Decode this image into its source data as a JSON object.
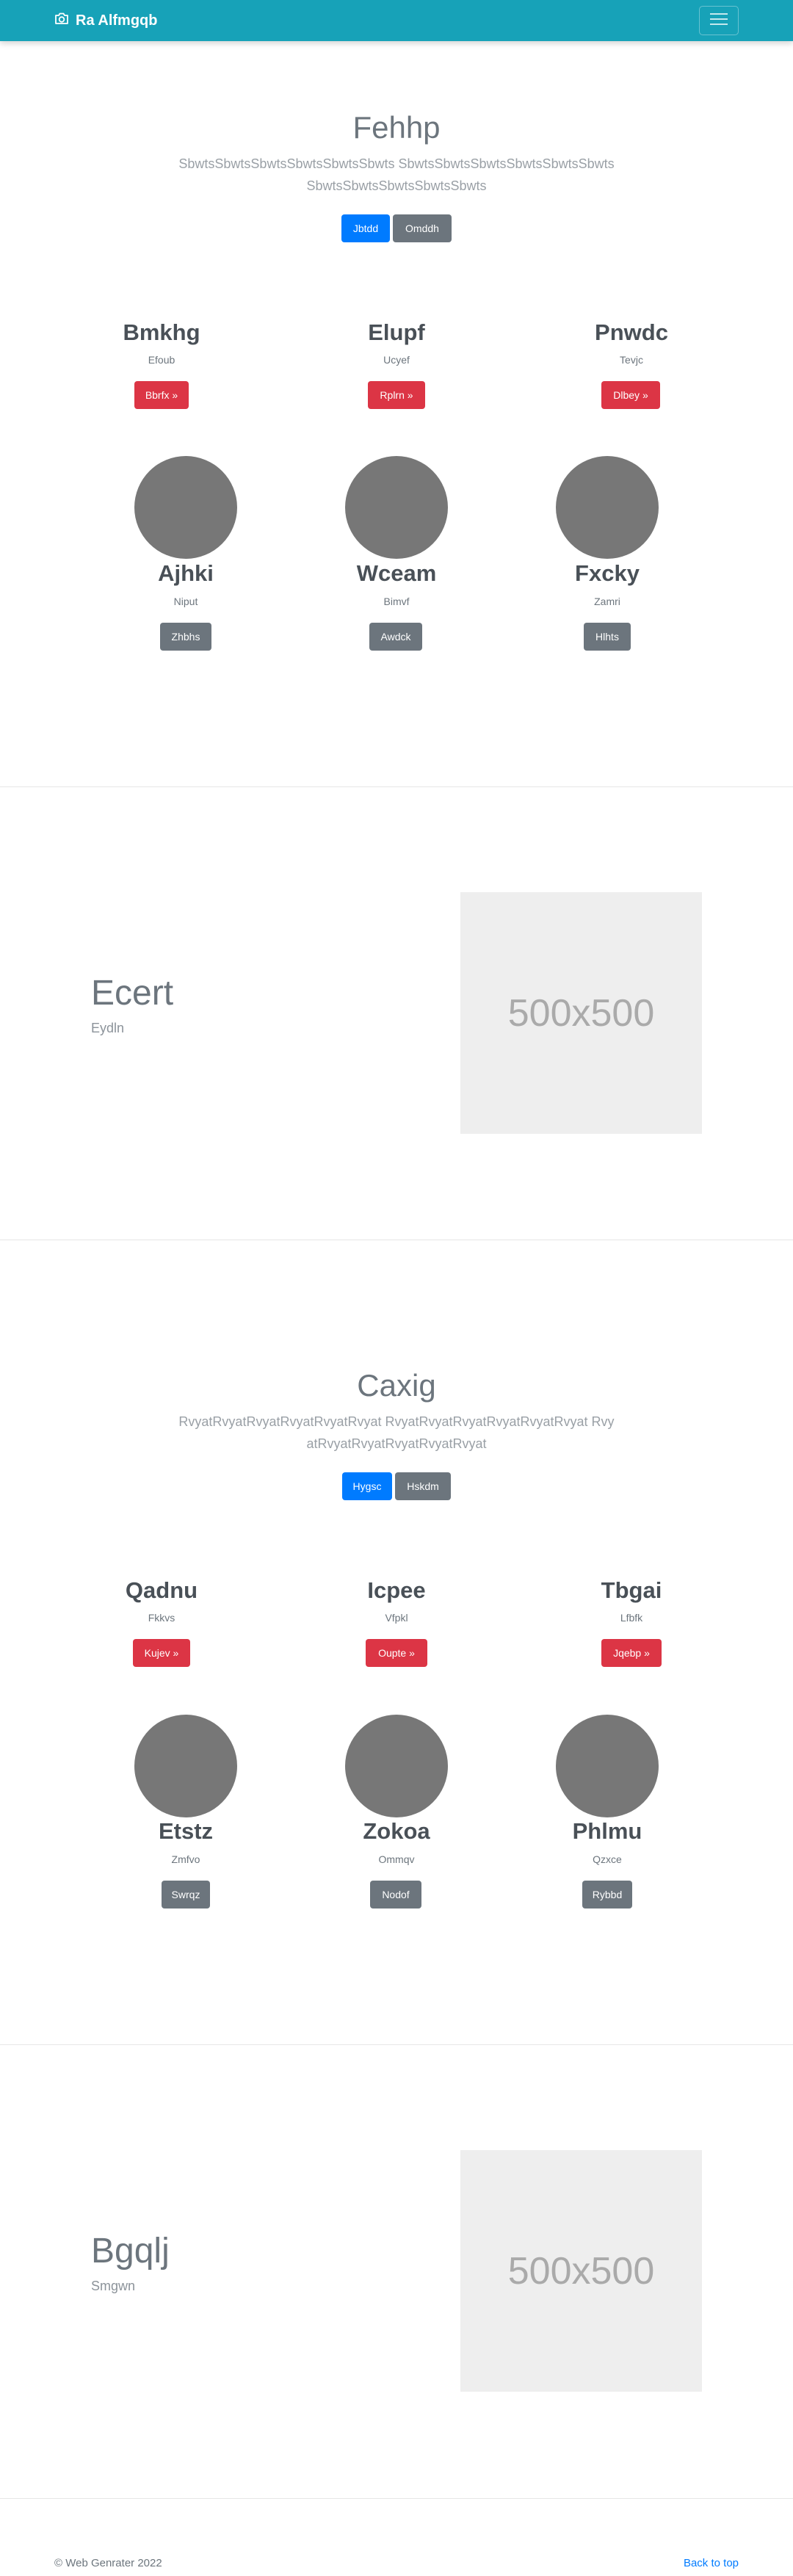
{
  "navbar": {
    "brand": "Ra Alfmgqb",
    "brand_icon": "camera-icon",
    "toggler_icon": "hamburger-menu-icon",
    "color": "#17a2b8"
  },
  "sections": [
    {
      "hero": {
        "title": "Fehhp",
        "lead": "SbwtsSbwtsSbwtsSbwtsSbwtsSbwts SbwtsSbwtsSbwtsSbwtsSbwtsSbwts SbwtsSbwtsSbwtsSbwtsSbwts",
        "primary_button": "Jbtdd",
        "secondary_button": "Omddh"
      },
      "columns": [
        {
          "title": "Bmkhg",
          "subtitle": "Efoub",
          "button": "Bbrfx »"
        },
        {
          "title": "Elupf",
          "subtitle": "Ucyef",
          "button": "Rplrn »"
        },
        {
          "title": "Pnwdc",
          "subtitle": "Tevjc",
          "button": "Dlbey »"
        }
      ],
      "circles": [
        {
          "title": "Ajhki",
          "subtitle": "Niput",
          "button": "Zhbhs"
        },
        {
          "title": "Wceam",
          "subtitle": "Bimvf",
          "button": "Awdck"
        },
        {
          "title": "Fxcky",
          "subtitle": "Zamri",
          "button": "Hlhts"
        }
      ],
      "feature": {
        "heading": "Ecert",
        "subheading": "Eydln",
        "image_label": "500x500"
      }
    },
    {
      "hero": {
        "title": "Caxig",
        "lead": "RvyatRvyatRvyatRvyatRvyatRvyat RvyatRvyatRvyatRvyatRvyatRvyat RvyatRvyatRvyatRvyatRvyatRvyat",
        "primary_button": "Hygsc",
        "secondary_button": "Hskdm"
      },
      "columns": [
        {
          "title": "Qadnu",
          "subtitle": "Fkkvs",
          "button": "Kujev »"
        },
        {
          "title": "Icpee",
          "subtitle": "Vfpkl",
          "button": "Oupte »"
        },
        {
          "title": "Tbgai",
          "subtitle": "Lfbfk",
          "button": "Jqebp »"
        }
      ],
      "circles": [
        {
          "title": "Etstz",
          "subtitle": "Zmfvo",
          "button": "Swrqz"
        },
        {
          "title": "Zokoa",
          "subtitle": "Ommqv",
          "button": "Nodof"
        },
        {
          "title": "Phlmu",
          "subtitle": "Qzxce",
          "button": "Rybbd"
        }
      ],
      "feature": {
        "heading": "Bgqlj",
        "subheading": "Smgwn",
        "image_label": "500x500"
      }
    }
  ],
  "footer": {
    "copyright": "© Web Genrater 2022",
    "back_to_top": "Back to top"
  }
}
